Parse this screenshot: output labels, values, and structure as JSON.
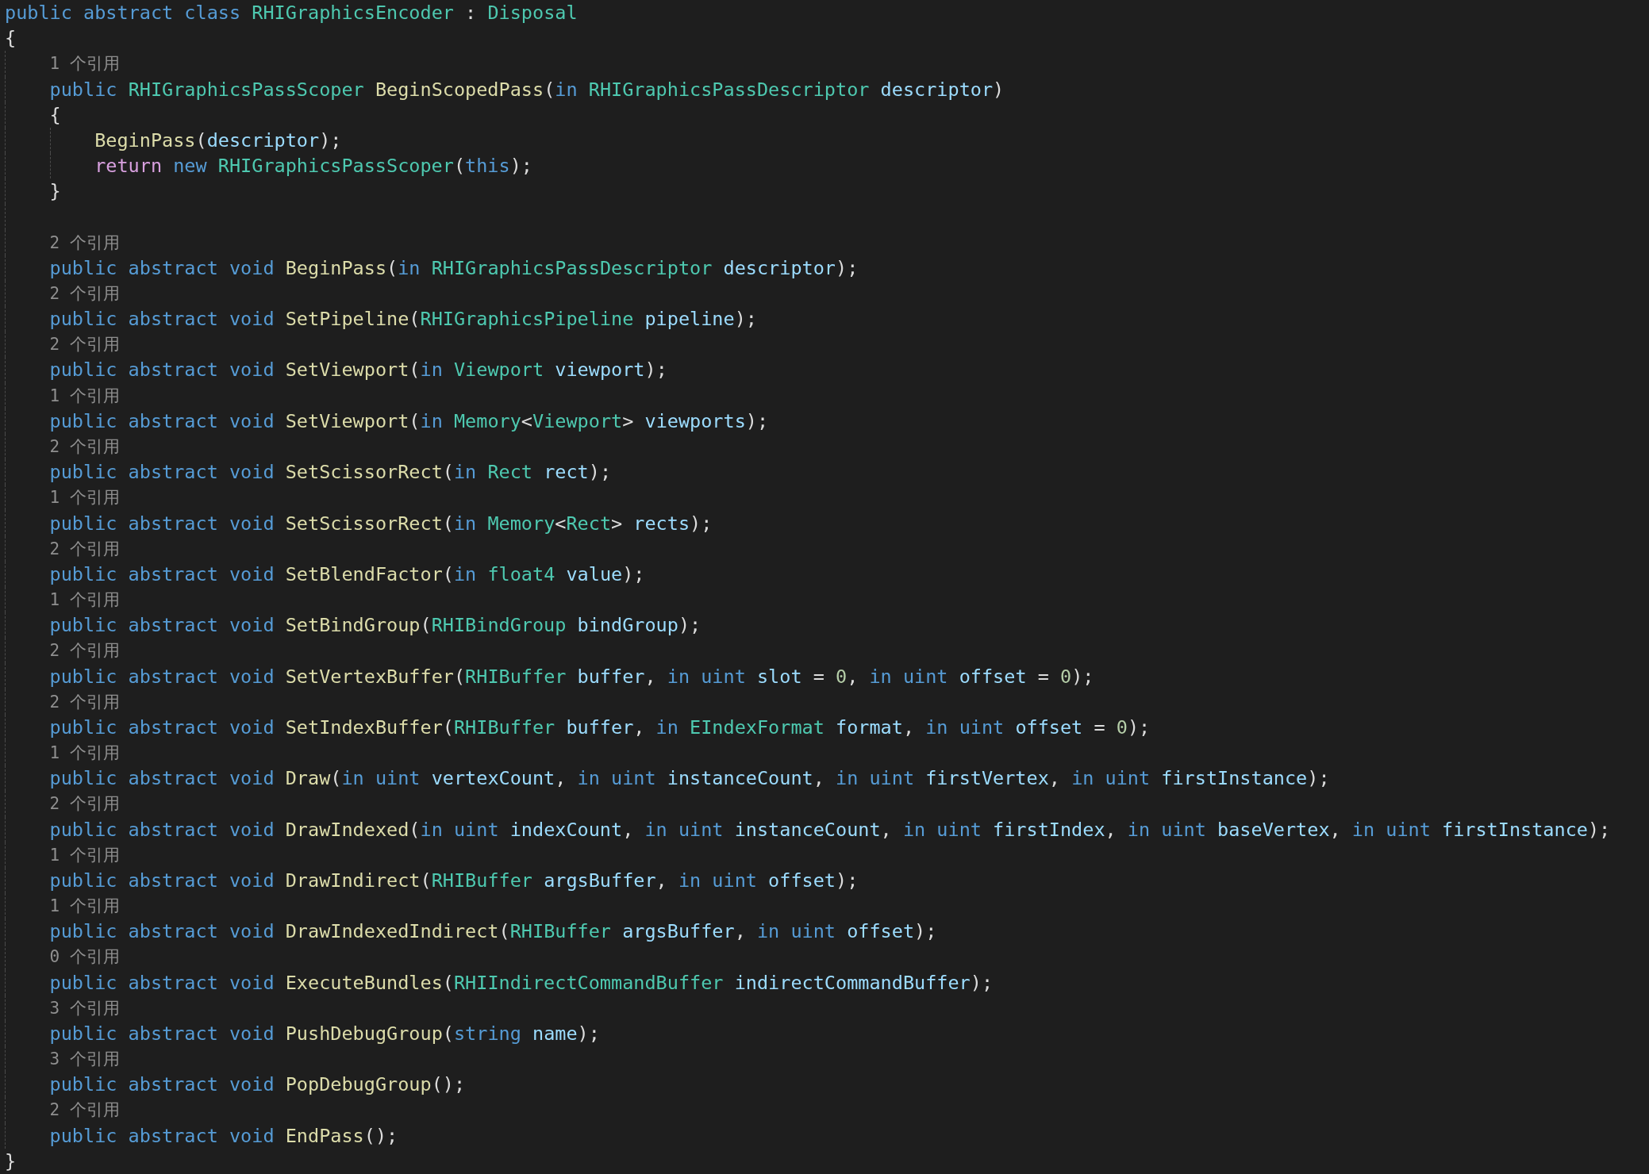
{
  "editor": {
    "header": [
      {
        "kind": "kw",
        "text": "public abstract class "
      },
      {
        "kind": "type",
        "text": "RHIGraphicsEncoder"
      },
      {
        "kind": "plain",
        "text": " : "
      },
      {
        "kind": "type",
        "text": "Disposal"
      }
    ],
    "open_brace": "{",
    "members": [
      {
        "references": "1 个引用",
        "signature": [
          {
            "kind": "kw",
            "text": "public "
          },
          {
            "kind": "type",
            "text": "RHIGraphicsPassScoper "
          },
          {
            "kind": "method",
            "text": "BeginScopedPass"
          },
          {
            "kind": "plain",
            "text": "("
          },
          {
            "kind": "kw",
            "text": "in "
          },
          {
            "kind": "type",
            "text": "RHIGraphicsPassDescriptor "
          },
          {
            "kind": "param",
            "text": "descriptor"
          },
          {
            "kind": "plain",
            "text": ")"
          }
        ],
        "body": {
          "open": "{",
          "lines": [
            [
              {
                "kind": "method",
                "text": "BeginPass"
              },
              {
                "kind": "plain",
                "text": "("
              },
              {
                "kind": "param",
                "text": "descriptor"
              },
              {
                "kind": "plain",
                "text": ");"
              }
            ],
            [
              {
                "kind": "ctrl",
                "text": "return "
              },
              {
                "kind": "kw",
                "text": "new "
              },
              {
                "kind": "type",
                "text": "RHIGraphicsPassScoper"
              },
              {
                "kind": "plain",
                "text": "("
              },
              {
                "kind": "kw",
                "text": "this"
              },
              {
                "kind": "plain",
                "text": ");"
              }
            ]
          ],
          "close": "}"
        }
      },
      {
        "references": "2 个引用",
        "signature": [
          {
            "kind": "kw",
            "text": "public abstract void "
          },
          {
            "kind": "method",
            "text": "BeginPass"
          },
          {
            "kind": "plain",
            "text": "("
          },
          {
            "kind": "kw",
            "text": "in "
          },
          {
            "kind": "type",
            "text": "RHIGraphicsPassDescriptor "
          },
          {
            "kind": "param",
            "text": "descriptor"
          },
          {
            "kind": "plain",
            "text": ");"
          }
        ]
      },
      {
        "references": "2 个引用",
        "signature": [
          {
            "kind": "kw",
            "text": "public abstract void "
          },
          {
            "kind": "method",
            "text": "SetPipeline"
          },
          {
            "kind": "plain",
            "text": "("
          },
          {
            "kind": "type",
            "text": "RHIGraphicsPipeline "
          },
          {
            "kind": "param",
            "text": "pipeline"
          },
          {
            "kind": "plain",
            "text": ");"
          }
        ]
      },
      {
        "references": "2 个引用",
        "signature": [
          {
            "kind": "kw",
            "text": "public abstract void "
          },
          {
            "kind": "method",
            "text": "SetViewport"
          },
          {
            "kind": "plain",
            "text": "("
          },
          {
            "kind": "kw",
            "text": "in "
          },
          {
            "kind": "type",
            "text": "Viewport "
          },
          {
            "kind": "param",
            "text": "viewport"
          },
          {
            "kind": "plain",
            "text": ");"
          }
        ]
      },
      {
        "references": "1 个引用",
        "signature": [
          {
            "kind": "kw",
            "text": "public abstract void "
          },
          {
            "kind": "method",
            "text": "SetViewport"
          },
          {
            "kind": "plain",
            "text": "("
          },
          {
            "kind": "kw",
            "text": "in "
          },
          {
            "kind": "type",
            "text": "Memory"
          },
          {
            "kind": "plain",
            "text": "<"
          },
          {
            "kind": "type",
            "text": "Viewport"
          },
          {
            "kind": "plain",
            "text": "> "
          },
          {
            "kind": "param",
            "text": "viewports"
          },
          {
            "kind": "plain",
            "text": ");"
          }
        ]
      },
      {
        "references": "2 个引用",
        "signature": [
          {
            "kind": "kw",
            "text": "public abstract void "
          },
          {
            "kind": "method",
            "text": "SetScissorRect"
          },
          {
            "kind": "plain",
            "text": "("
          },
          {
            "kind": "kw",
            "text": "in "
          },
          {
            "kind": "type",
            "text": "Rect "
          },
          {
            "kind": "param",
            "text": "rect"
          },
          {
            "kind": "plain",
            "text": ");"
          }
        ]
      },
      {
        "references": "1 个引用",
        "signature": [
          {
            "kind": "kw",
            "text": "public abstract void "
          },
          {
            "kind": "method",
            "text": "SetScissorRect"
          },
          {
            "kind": "plain",
            "text": "("
          },
          {
            "kind": "kw",
            "text": "in "
          },
          {
            "kind": "type",
            "text": "Memory"
          },
          {
            "kind": "plain",
            "text": "<"
          },
          {
            "kind": "type",
            "text": "Rect"
          },
          {
            "kind": "plain",
            "text": "> "
          },
          {
            "kind": "param",
            "text": "rects"
          },
          {
            "kind": "plain",
            "text": ");"
          }
        ]
      },
      {
        "references": "2 个引用",
        "signature": [
          {
            "kind": "kw",
            "text": "public abstract void "
          },
          {
            "kind": "method",
            "text": "SetBlendFactor"
          },
          {
            "kind": "plain",
            "text": "("
          },
          {
            "kind": "kw",
            "text": "in "
          },
          {
            "kind": "type",
            "text": "float4 "
          },
          {
            "kind": "param",
            "text": "value"
          },
          {
            "kind": "plain",
            "text": ");"
          }
        ]
      },
      {
        "references": "1 个引用",
        "signature": [
          {
            "kind": "kw",
            "text": "public abstract void "
          },
          {
            "kind": "method",
            "text": "SetBindGroup"
          },
          {
            "kind": "plain",
            "text": "("
          },
          {
            "kind": "type",
            "text": "RHIBindGroup "
          },
          {
            "kind": "param",
            "text": "bindGroup"
          },
          {
            "kind": "plain",
            "text": ");"
          }
        ]
      },
      {
        "references": "2 个引用",
        "signature": [
          {
            "kind": "kw",
            "text": "public abstract void "
          },
          {
            "kind": "method",
            "text": "SetVertexBuffer"
          },
          {
            "kind": "plain",
            "text": "("
          },
          {
            "kind": "type",
            "text": "RHIBuffer "
          },
          {
            "kind": "param",
            "text": "buffer"
          },
          {
            "kind": "plain",
            "text": ", "
          },
          {
            "kind": "kw",
            "text": "in uint "
          },
          {
            "kind": "param",
            "text": "slot"
          },
          {
            "kind": "plain",
            "text": " = "
          },
          {
            "kind": "num",
            "text": "0"
          },
          {
            "kind": "plain",
            "text": ", "
          },
          {
            "kind": "kw",
            "text": "in uint "
          },
          {
            "kind": "param",
            "text": "offset"
          },
          {
            "kind": "plain",
            "text": " = "
          },
          {
            "kind": "num",
            "text": "0"
          },
          {
            "kind": "plain",
            "text": ");"
          }
        ]
      },
      {
        "references": "2 个引用",
        "signature": [
          {
            "kind": "kw",
            "text": "public abstract void "
          },
          {
            "kind": "method",
            "text": "SetIndexBuffer"
          },
          {
            "kind": "plain",
            "text": "("
          },
          {
            "kind": "type",
            "text": "RHIBuffer "
          },
          {
            "kind": "param",
            "text": "buffer"
          },
          {
            "kind": "plain",
            "text": ", "
          },
          {
            "kind": "kw",
            "text": "in "
          },
          {
            "kind": "type",
            "text": "EIndexFormat "
          },
          {
            "kind": "param",
            "text": "format"
          },
          {
            "kind": "plain",
            "text": ", "
          },
          {
            "kind": "kw",
            "text": "in uint "
          },
          {
            "kind": "param",
            "text": "offset"
          },
          {
            "kind": "plain",
            "text": " = "
          },
          {
            "kind": "num",
            "text": "0"
          },
          {
            "kind": "plain",
            "text": ");"
          }
        ]
      },
      {
        "references": "1 个引用",
        "signature": [
          {
            "kind": "kw",
            "text": "public abstract void "
          },
          {
            "kind": "method",
            "text": "Draw"
          },
          {
            "kind": "plain",
            "text": "("
          },
          {
            "kind": "kw",
            "text": "in uint "
          },
          {
            "kind": "param",
            "text": "vertexCount"
          },
          {
            "kind": "plain",
            "text": ", "
          },
          {
            "kind": "kw",
            "text": "in uint "
          },
          {
            "kind": "param",
            "text": "instanceCount"
          },
          {
            "kind": "plain",
            "text": ", "
          },
          {
            "kind": "kw",
            "text": "in uint "
          },
          {
            "kind": "param",
            "text": "firstVertex"
          },
          {
            "kind": "plain",
            "text": ", "
          },
          {
            "kind": "kw",
            "text": "in uint "
          },
          {
            "kind": "param",
            "text": "firstInstance"
          },
          {
            "kind": "plain",
            "text": ");"
          }
        ]
      },
      {
        "references": "2 个引用",
        "signature": [
          {
            "kind": "kw",
            "text": "public abstract void "
          },
          {
            "kind": "method",
            "text": "DrawIndexed"
          },
          {
            "kind": "plain",
            "text": "("
          },
          {
            "kind": "kw",
            "text": "in uint "
          },
          {
            "kind": "param",
            "text": "indexCount"
          },
          {
            "kind": "plain",
            "text": ", "
          },
          {
            "kind": "kw",
            "text": "in uint "
          },
          {
            "kind": "param",
            "text": "instanceCount"
          },
          {
            "kind": "plain",
            "text": ", "
          },
          {
            "kind": "kw",
            "text": "in uint "
          },
          {
            "kind": "param",
            "text": "firstIndex"
          },
          {
            "kind": "plain",
            "text": ", "
          },
          {
            "kind": "kw",
            "text": "in uint "
          },
          {
            "kind": "param",
            "text": "baseVertex"
          },
          {
            "kind": "plain",
            "text": ", "
          },
          {
            "kind": "kw",
            "text": "in uint "
          },
          {
            "kind": "param",
            "text": "firstInstance"
          },
          {
            "kind": "plain",
            "text": ");"
          }
        ]
      },
      {
        "references": "1 个引用",
        "signature": [
          {
            "kind": "kw",
            "text": "public abstract void "
          },
          {
            "kind": "method",
            "text": "DrawIndirect"
          },
          {
            "kind": "plain",
            "text": "("
          },
          {
            "kind": "type",
            "text": "RHIBuffer "
          },
          {
            "kind": "param",
            "text": "argsBuffer"
          },
          {
            "kind": "plain",
            "text": ", "
          },
          {
            "kind": "kw",
            "text": "in uint "
          },
          {
            "kind": "param",
            "text": "offset"
          },
          {
            "kind": "plain",
            "text": ");"
          }
        ]
      },
      {
        "references": "1 个引用",
        "signature": [
          {
            "kind": "kw",
            "text": "public abstract void "
          },
          {
            "kind": "method",
            "text": "DrawIndexedIndirect"
          },
          {
            "kind": "plain",
            "text": "("
          },
          {
            "kind": "type",
            "text": "RHIBuffer "
          },
          {
            "kind": "param",
            "text": "argsBuffer"
          },
          {
            "kind": "plain",
            "text": ", "
          },
          {
            "kind": "kw",
            "text": "in uint "
          },
          {
            "kind": "param",
            "text": "offset"
          },
          {
            "kind": "plain",
            "text": ");"
          }
        ]
      },
      {
        "references": "0 个引用",
        "signature": [
          {
            "kind": "kw",
            "text": "public abstract void "
          },
          {
            "kind": "method",
            "text": "ExecuteBundles"
          },
          {
            "kind": "plain",
            "text": "("
          },
          {
            "kind": "type",
            "text": "RHIIndirectCommandBuffer "
          },
          {
            "kind": "param",
            "text": "indirectCommandBuffer"
          },
          {
            "kind": "plain",
            "text": ");"
          }
        ]
      },
      {
        "references": "3 个引用",
        "signature": [
          {
            "kind": "kw",
            "text": "public abstract void "
          },
          {
            "kind": "method",
            "text": "PushDebugGroup"
          },
          {
            "kind": "plain",
            "text": "("
          },
          {
            "kind": "kw",
            "text": "string "
          },
          {
            "kind": "param",
            "text": "name"
          },
          {
            "kind": "plain",
            "text": ");"
          }
        ]
      },
      {
        "references": "3 个引用",
        "signature": [
          {
            "kind": "kw",
            "text": "public abstract void "
          },
          {
            "kind": "method",
            "text": "PopDebugGroup"
          },
          {
            "kind": "plain",
            "text": "();"
          }
        ]
      },
      {
        "references": "2 个引用",
        "signature": [
          {
            "kind": "kw",
            "text": "public abstract void "
          },
          {
            "kind": "method",
            "text": "EndPass"
          },
          {
            "kind": "plain",
            "text": "();"
          }
        ]
      }
    ],
    "close_brace": "}"
  }
}
